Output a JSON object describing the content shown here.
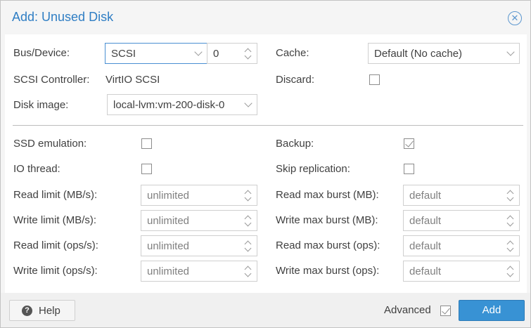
{
  "dialog": {
    "title": "Add: Unused Disk",
    "close_icon": "close-circle-icon"
  },
  "general": {
    "bus_device_label": "Bus/Device:",
    "bus_value": "SCSI",
    "device_value": "0",
    "scsi_controller_label": "SCSI Controller:",
    "scsi_controller_value": "VirtIO SCSI",
    "disk_image_label": "Disk image:",
    "disk_image_value": "local-lvm:vm-200-disk-0",
    "cache_label": "Cache:",
    "cache_value": "Default (No cache)",
    "discard_label": "Discard:",
    "discard_checked": false
  },
  "advanced": {
    "ssd_label": "SSD emulation:",
    "ssd_checked": false,
    "iothread_label": "IO thread:",
    "iothread_checked": false,
    "backup_label": "Backup:",
    "backup_checked": true,
    "skip_replication_label": "Skip replication:",
    "skip_replication_checked": false,
    "read_limit_mb_label": "Read limit (MB/s):",
    "read_limit_mb_placeholder": "unlimited",
    "write_limit_mb_label": "Write limit (MB/s):",
    "write_limit_mb_placeholder": "unlimited",
    "read_limit_ops_label": "Read limit (ops/s):",
    "read_limit_ops_placeholder": "unlimited",
    "write_limit_ops_label": "Write limit (ops/s):",
    "write_limit_ops_placeholder": "unlimited",
    "read_burst_mb_label": "Read max burst (MB):",
    "read_burst_mb_placeholder": "default",
    "write_burst_mb_label": "Write max burst (MB):",
    "write_burst_mb_placeholder": "default",
    "read_burst_ops_label": "Read max burst (ops):",
    "read_burst_ops_placeholder": "default",
    "write_burst_ops_label": "Write max burst (ops):",
    "write_burst_ops_placeholder": "default"
  },
  "footer": {
    "help_label": "Help",
    "advanced_label": "Advanced",
    "advanced_checked": true,
    "add_label": "Add"
  },
  "colors": {
    "title": "#2f7ec4",
    "primary_button": "#3892d4",
    "focus_border": "#4a8fd2"
  }
}
